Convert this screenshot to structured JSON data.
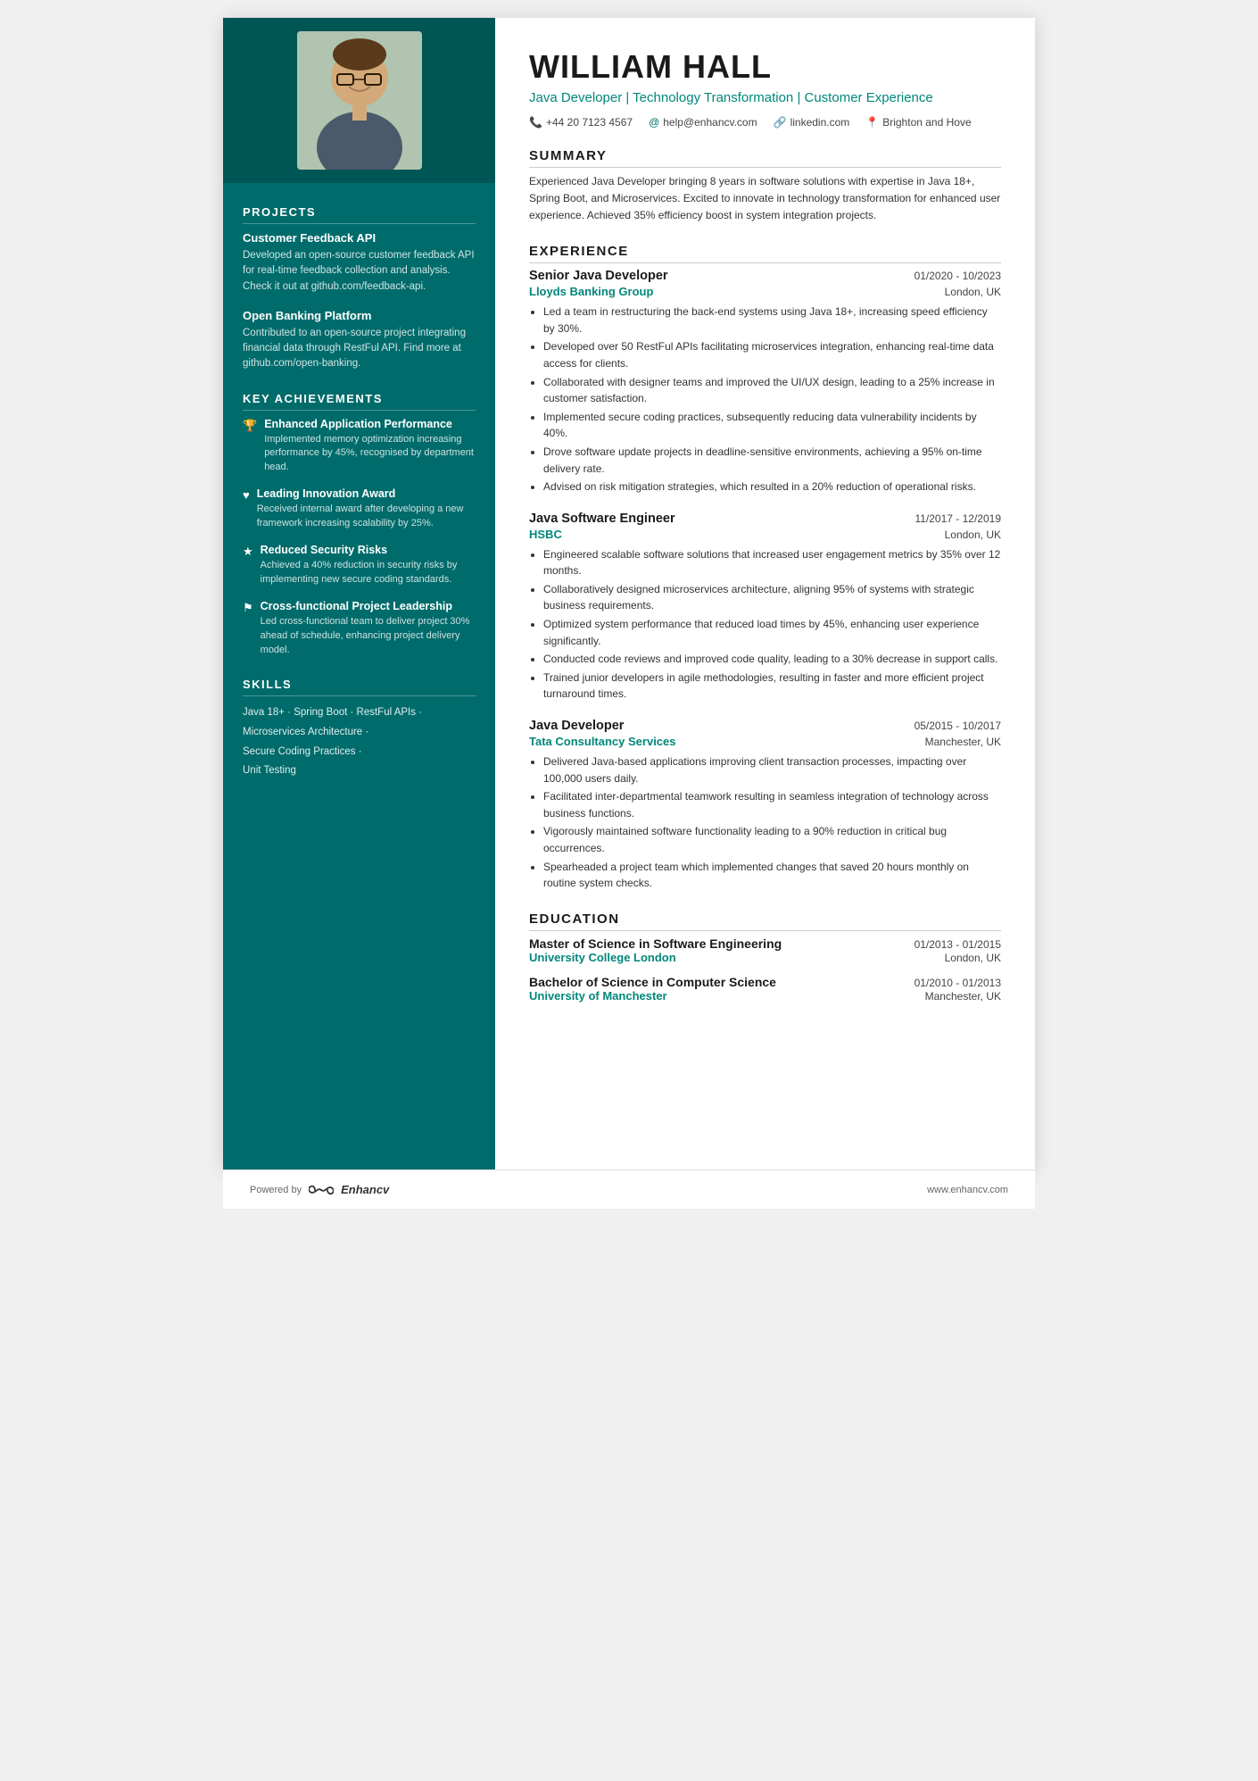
{
  "header": {
    "name": "WILLIAM HALL",
    "title": "Java Developer | Technology Transformation | Customer Experience",
    "phone": "+44 20 7123 4567",
    "email": "help@enhancv.com",
    "linkedin": "linkedin.com",
    "location": "Brighton and Hove"
  },
  "sidebar": {
    "sections": {
      "projects_title": "PROJECTS",
      "achievements_title": "KEY ACHIEVEMENTS",
      "skills_title": "SKILLS"
    },
    "projects": [
      {
        "name": "Customer Feedback API",
        "desc": "Developed an open-source customer feedback API for real-time feedback collection and analysis. Check it out at github.com/feedback-api."
      },
      {
        "name": "Open Banking Platform",
        "desc": "Contributed to an open-source project integrating financial data through RestFul API. Find more at github.com/open-banking."
      }
    ],
    "achievements": [
      {
        "icon": "🏆",
        "title": "Enhanced Application Performance",
        "desc": "Implemented memory optimization increasing performance by 45%, recognised by department head."
      },
      {
        "icon": "♥",
        "title": "Leading Innovation Award",
        "desc": "Received internal award after developing a new framework increasing scalability by 25%."
      },
      {
        "icon": "★",
        "title": "Reduced Security Risks",
        "desc": "Achieved a 40% reduction in security risks by implementing new secure coding standards."
      },
      {
        "icon": "⚑",
        "title": "Cross-functional Project Leadership",
        "desc": "Led cross-functional team to deliver project 30% ahead of schedule, enhancing project delivery model."
      }
    ],
    "skills": [
      "Java 18+ · Spring Boot · RestFul APIs ·",
      "Microservices Architecture ·",
      "Secure Coding Practices ·",
      "Unit Testing"
    ]
  },
  "main": {
    "summary_title": "SUMMARY",
    "summary": "Experienced Java Developer bringing 8 years in software solutions with expertise in Java 18+, Spring Boot, and Microservices. Excited to innovate in technology transformation for enhanced user experience. Achieved 35% efficiency boost in system integration projects.",
    "experience_title": "EXPERIENCE",
    "experience": [
      {
        "role": "Senior Java Developer",
        "dates": "01/2020 - 10/2023",
        "company": "Lloyds Banking Group",
        "location": "London, UK",
        "bullets": [
          "Led a team in restructuring the back-end systems using Java 18+, increasing speed efficiency by 30%.",
          "Developed over 50 RestFul APIs facilitating microservices integration, enhancing real-time data access for clients.",
          "Collaborated with designer teams and improved the UI/UX design, leading to a 25% increase in customer satisfaction.",
          "Implemented secure coding practices, subsequently reducing data vulnerability incidents by 40%.",
          "Drove software update projects in deadline-sensitive environments, achieving a 95% on-time delivery rate.",
          "Advised on risk mitigation strategies, which resulted in a 20% reduction of operational risks."
        ]
      },
      {
        "role": "Java Software Engineer",
        "dates": "11/2017 - 12/2019",
        "company": "HSBC",
        "location": "London, UK",
        "bullets": [
          "Engineered scalable software solutions that increased user engagement metrics by 35% over 12 months.",
          "Collaboratively designed microservices architecture, aligning 95% of systems with strategic business requirements.",
          "Optimized system performance that reduced load times by 45%, enhancing user experience significantly.",
          "Conducted code reviews and improved code quality, leading to a 30% decrease in support calls.",
          "Trained junior developers in agile methodologies, resulting in faster and more efficient project turnaround times."
        ]
      },
      {
        "role": "Java Developer",
        "dates": "05/2015 - 10/2017",
        "company": "Tata Consultancy Services",
        "location": "Manchester, UK",
        "bullets": [
          "Delivered Java-based applications improving client transaction processes, impacting over 100,000 users daily.",
          "Facilitated inter-departmental teamwork resulting in seamless integration of technology across business functions.",
          "Vigorously maintained software functionality leading to a 90% reduction in critical bug occurrences.",
          "Spearheaded a project team which implemented changes that saved 20 hours monthly on routine system checks."
        ]
      }
    ],
    "education_title": "EDUCATION",
    "education": [
      {
        "degree": "Master of Science in Software Engineering",
        "dates": "01/2013 - 01/2015",
        "school": "University College London",
        "location": "London, UK"
      },
      {
        "degree": "Bachelor of Science in Computer Science",
        "dates": "01/2010 - 01/2013",
        "school": "University of Manchester",
        "location": "Manchester, UK"
      }
    ]
  },
  "footer": {
    "powered_by": "Powered by",
    "brand": "Enhancv",
    "website": "www.enhancv.com"
  }
}
